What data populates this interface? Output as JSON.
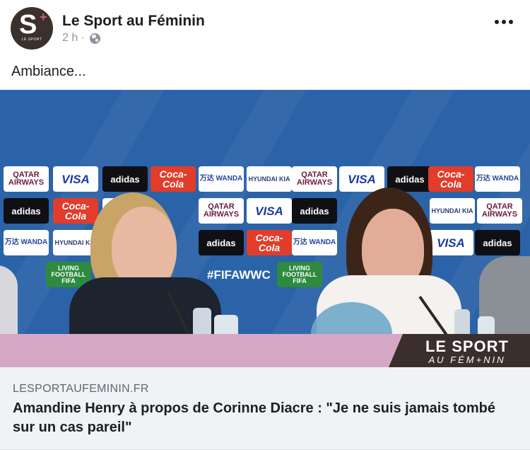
{
  "header": {
    "page_name": "Le Sport au Féminin",
    "time": "2 h",
    "separator": "·",
    "avatar_letter": "S",
    "avatar_plus": "+",
    "avatar_caption": "LE SPORT"
  },
  "post": {
    "text": "Ambiance..."
  },
  "photo": {
    "sponsors": [
      "QATAR AIRWAYS",
      "VISA",
      "adidas",
      "Coca-Cola",
      "万达 WANDA",
      "HYUNDAI KIA",
      "#FIFAWWC",
      "LIVING FOOTBALL FIFA"
    ],
    "banner_brand_line1": "LE SPORT",
    "banner_brand_line2": "AU FÉM+NIN",
    "colors": {
      "board_blue": "#2a63a8",
      "banner_pink": "#d7a7c6",
      "brand_dark": "#3a2f2c"
    }
  },
  "link": {
    "domain": "LESPORTAUFEMININ.FR",
    "title": "Amandine Henry à propos de Corinne Diacre : \"Je ne suis jamais tombé sur un cas pareil\""
  },
  "icons": {
    "privacy": "globe-icon",
    "menu": "more-options-icon"
  }
}
